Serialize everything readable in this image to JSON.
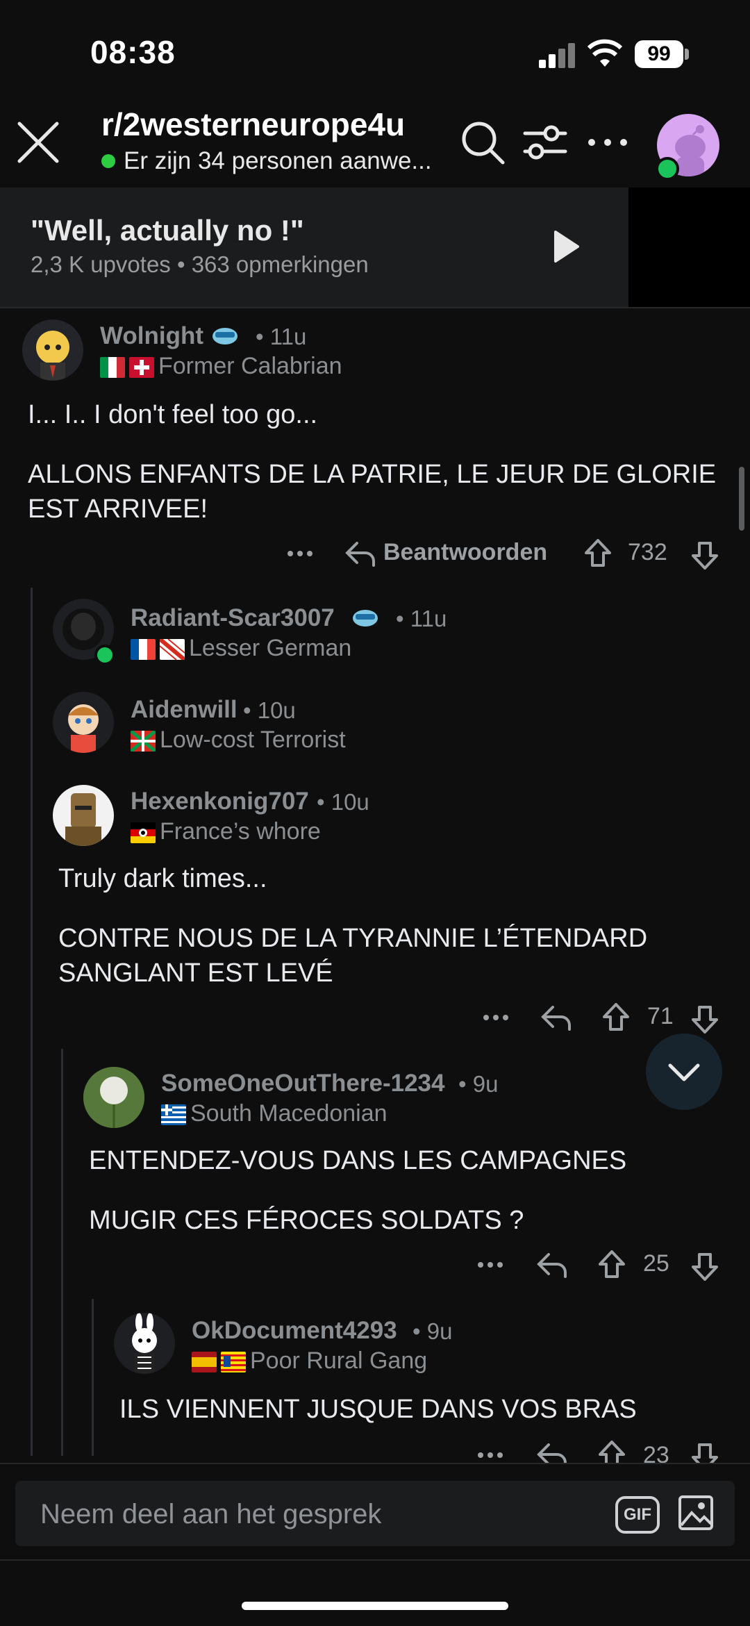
{
  "status_bar": {
    "time": "08:38",
    "battery": "99"
  },
  "header": {
    "subreddit": "r/2westerneurope4u",
    "online_text": "Er zijn 34 personen aanwe..."
  },
  "post": {
    "title": "\"Well, actually no !\"",
    "meta": "2,3 K upvotes • 363 opmerkingen"
  },
  "comments": [
    {
      "user": "Wolnight",
      "time": "• 11u",
      "flair": "Former Calabrian",
      "body": [
        "I... I.. I don't feel too go...",
        "ALLONS ENFANTS DE LA PATRIE, LE JEUR DE GLORIE EST ARRIVEE!"
      ],
      "reply_label": "Beantwoorden",
      "votes": "732"
    },
    {
      "user": "Radiant-Scar3007",
      "time": "• 11u",
      "flair": "Lesser German"
    },
    {
      "user": "Aidenwill",
      "time": "• 10u",
      "flair": "Low-cost Terrorist"
    },
    {
      "user": "Hexenkonig707",
      "time": "• 10u",
      "flair": "France’s whore",
      "body": [
        "Truly dark times...",
        "CONTRE NOUS DE LA TYRANNIE L’ÉTENDARD SANGLANT EST LEVÉ"
      ],
      "votes": "71"
    },
    {
      "user": "SomeOneOutThere-1234",
      "time": "• 9u",
      "flair": "South Macedonian",
      "body": [
        "ENTENDEZ-VOUS DANS LES CAMPAGNES",
        "MUGIR CES FÉROCES SOLDATS ?"
      ],
      "votes": "25"
    },
    {
      "user": "OkDocument4293",
      "time": "• 9u",
      "flair": "Poor Rural Gang",
      "body": [
        "ILS VIENNENT JUSQUE DANS VOS BRAS"
      ],
      "votes": "23"
    }
  ],
  "composer": {
    "placeholder": "Neem deel aan het gesprek",
    "gif_label": "GIF"
  },
  "colors": {
    "background": "#0e0e0f",
    "online_green": "#2ecc40",
    "avatar_purple": "#d9a6f2"
  }
}
